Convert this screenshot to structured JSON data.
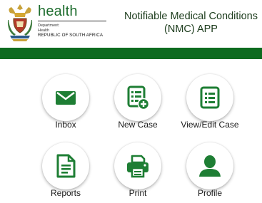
{
  "header": {
    "brand": {
      "name": "health",
      "department_label": "Department:",
      "department_name": "Health",
      "country": "REPUBLIC OF SOUTH AFRICA"
    },
    "app_title_line1": "Notifiable Medical Conditions",
    "app_title_line2": "(NMC) APP"
  },
  "colors": {
    "brand_green": "#0d6b1f",
    "icon_green": "#1e7e34",
    "background": "#ffffff"
  },
  "menu": {
    "items": [
      {
        "label": "Inbox",
        "icon": "envelope-icon"
      },
      {
        "label": "New Case",
        "icon": "clipboard-plus-icon"
      },
      {
        "label": "View/Edit Case",
        "icon": "list-icon"
      },
      {
        "label": "Reports",
        "icon": "document-icon"
      },
      {
        "label": "Print",
        "icon": "printer-icon"
      },
      {
        "label": "Profile",
        "icon": "user-icon"
      }
    ]
  }
}
